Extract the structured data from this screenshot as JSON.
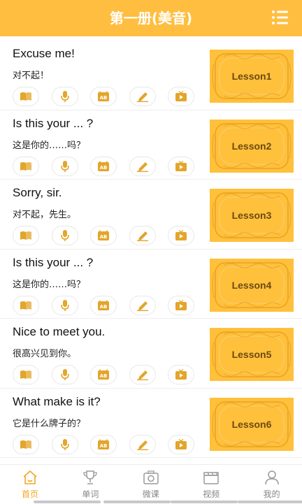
{
  "header": {
    "title": "第一册(美音)",
    "menu_icon": "list-menu-icon"
  },
  "colors": {
    "accent": "#FFBE3F",
    "active_tab": "#F5A623",
    "icon_stroke": "#E3A52A"
  },
  "lessons": [
    {
      "en": "Excuse me!",
      "cn": "对不起！",
      "thumb": "Lesson1"
    },
    {
      "en": "Is this your ... ?",
      "cn": "这是你的……吗？",
      "thumb": "Lesson2"
    },
    {
      "en": "Sorry, sir.",
      "cn": "对不起，先生。",
      "thumb": "Lesson3"
    },
    {
      "en": "Is this your ... ?",
      "cn": "这是你的……吗？",
      "thumb": "Lesson4"
    },
    {
      "en": "Nice to meet you.",
      "cn": "很高兴见到你。",
      "thumb": "Lesson5"
    },
    {
      "en": "What make is it?",
      "cn": "它是什么牌子的？",
      "thumb": "Lesson6"
    }
  ],
  "lesson_actions": [
    "book-icon",
    "microphone-icon",
    "ab-compare-icon",
    "pencil-write-icon",
    "video-play-icon"
  ],
  "tabs": [
    {
      "label": "首页",
      "icon": "home-icon",
      "active": true
    },
    {
      "label": "单词",
      "icon": "trophy-icon",
      "active": false
    },
    {
      "label": "微课",
      "icon": "camera-icon",
      "active": false
    },
    {
      "label": "视频",
      "icon": "clapperboard-icon",
      "active": false
    },
    {
      "label": "我的",
      "icon": "user-icon",
      "active": false
    }
  ]
}
